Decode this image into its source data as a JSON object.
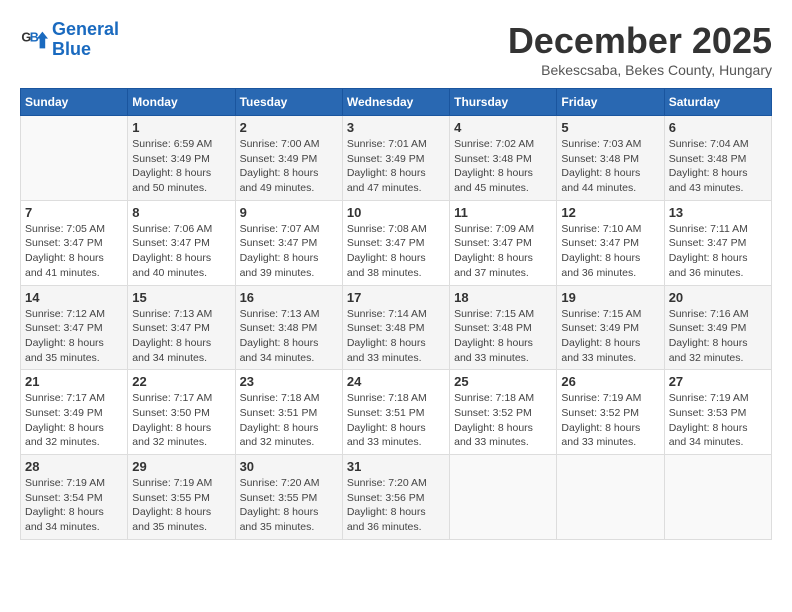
{
  "logo": {
    "line1": "General",
    "line2": "Blue"
  },
  "header": {
    "title": "December 2025",
    "subtitle": "Bekescsaba, Bekes County, Hungary"
  },
  "weekdays": [
    "Sunday",
    "Monday",
    "Tuesday",
    "Wednesday",
    "Thursday",
    "Friday",
    "Saturday"
  ],
  "weeks": [
    [
      {
        "day": "",
        "info": ""
      },
      {
        "day": "1",
        "info": "Sunrise: 6:59 AM\nSunset: 3:49 PM\nDaylight: 8 hours\nand 50 minutes."
      },
      {
        "day": "2",
        "info": "Sunrise: 7:00 AM\nSunset: 3:49 PM\nDaylight: 8 hours\nand 49 minutes."
      },
      {
        "day": "3",
        "info": "Sunrise: 7:01 AM\nSunset: 3:49 PM\nDaylight: 8 hours\nand 47 minutes."
      },
      {
        "day": "4",
        "info": "Sunrise: 7:02 AM\nSunset: 3:48 PM\nDaylight: 8 hours\nand 45 minutes."
      },
      {
        "day": "5",
        "info": "Sunrise: 7:03 AM\nSunset: 3:48 PM\nDaylight: 8 hours\nand 44 minutes."
      },
      {
        "day": "6",
        "info": "Sunrise: 7:04 AM\nSunset: 3:48 PM\nDaylight: 8 hours\nand 43 minutes."
      }
    ],
    [
      {
        "day": "7",
        "info": "Sunrise: 7:05 AM\nSunset: 3:47 PM\nDaylight: 8 hours\nand 41 minutes."
      },
      {
        "day": "8",
        "info": "Sunrise: 7:06 AM\nSunset: 3:47 PM\nDaylight: 8 hours\nand 40 minutes."
      },
      {
        "day": "9",
        "info": "Sunrise: 7:07 AM\nSunset: 3:47 PM\nDaylight: 8 hours\nand 39 minutes."
      },
      {
        "day": "10",
        "info": "Sunrise: 7:08 AM\nSunset: 3:47 PM\nDaylight: 8 hours\nand 38 minutes."
      },
      {
        "day": "11",
        "info": "Sunrise: 7:09 AM\nSunset: 3:47 PM\nDaylight: 8 hours\nand 37 minutes."
      },
      {
        "day": "12",
        "info": "Sunrise: 7:10 AM\nSunset: 3:47 PM\nDaylight: 8 hours\nand 36 minutes."
      },
      {
        "day": "13",
        "info": "Sunrise: 7:11 AM\nSunset: 3:47 PM\nDaylight: 8 hours\nand 36 minutes."
      }
    ],
    [
      {
        "day": "14",
        "info": "Sunrise: 7:12 AM\nSunset: 3:47 PM\nDaylight: 8 hours\nand 35 minutes."
      },
      {
        "day": "15",
        "info": "Sunrise: 7:13 AM\nSunset: 3:47 PM\nDaylight: 8 hours\nand 34 minutes."
      },
      {
        "day": "16",
        "info": "Sunrise: 7:13 AM\nSunset: 3:48 PM\nDaylight: 8 hours\nand 34 minutes."
      },
      {
        "day": "17",
        "info": "Sunrise: 7:14 AM\nSunset: 3:48 PM\nDaylight: 8 hours\nand 33 minutes."
      },
      {
        "day": "18",
        "info": "Sunrise: 7:15 AM\nSunset: 3:48 PM\nDaylight: 8 hours\nand 33 minutes."
      },
      {
        "day": "19",
        "info": "Sunrise: 7:15 AM\nSunset: 3:49 PM\nDaylight: 8 hours\nand 33 minutes."
      },
      {
        "day": "20",
        "info": "Sunrise: 7:16 AM\nSunset: 3:49 PM\nDaylight: 8 hours\nand 32 minutes."
      }
    ],
    [
      {
        "day": "21",
        "info": "Sunrise: 7:17 AM\nSunset: 3:49 PM\nDaylight: 8 hours\nand 32 minutes."
      },
      {
        "day": "22",
        "info": "Sunrise: 7:17 AM\nSunset: 3:50 PM\nDaylight: 8 hours\nand 32 minutes."
      },
      {
        "day": "23",
        "info": "Sunrise: 7:18 AM\nSunset: 3:51 PM\nDaylight: 8 hours\nand 32 minutes."
      },
      {
        "day": "24",
        "info": "Sunrise: 7:18 AM\nSunset: 3:51 PM\nDaylight: 8 hours\nand 33 minutes."
      },
      {
        "day": "25",
        "info": "Sunrise: 7:18 AM\nSunset: 3:52 PM\nDaylight: 8 hours\nand 33 minutes."
      },
      {
        "day": "26",
        "info": "Sunrise: 7:19 AM\nSunset: 3:52 PM\nDaylight: 8 hours\nand 33 minutes."
      },
      {
        "day": "27",
        "info": "Sunrise: 7:19 AM\nSunset: 3:53 PM\nDaylight: 8 hours\nand 34 minutes."
      }
    ],
    [
      {
        "day": "28",
        "info": "Sunrise: 7:19 AM\nSunset: 3:54 PM\nDaylight: 8 hours\nand 34 minutes."
      },
      {
        "day": "29",
        "info": "Sunrise: 7:19 AM\nSunset: 3:55 PM\nDaylight: 8 hours\nand 35 minutes."
      },
      {
        "day": "30",
        "info": "Sunrise: 7:20 AM\nSunset: 3:55 PM\nDaylight: 8 hours\nand 35 minutes."
      },
      {
        "day": "31",
        "info": "Sunrise: 7:20 AM\nSunset: 3:56 PM\nDaylight: 8 hours\nand 36 minutes."
      },
      {
        "day": "",
        "info": ""
      },
      {
        "day": "",
        "info": ""
      },
      {
        "day": "",
        "info": ""
      }
    ]
  ]
}
